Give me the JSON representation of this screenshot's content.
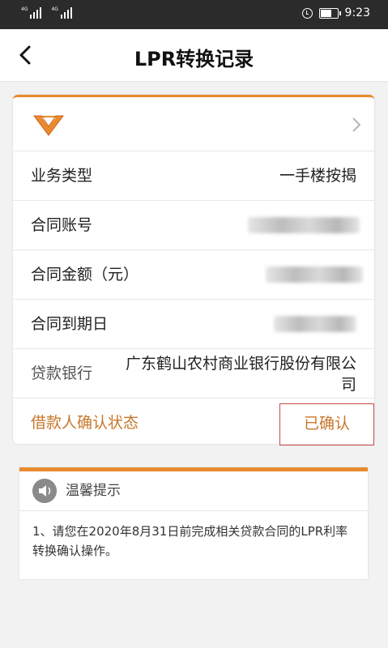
{
  "status_bar": {
    "network_1": "4G",
    "network_2": "4G",
    "time": "9:23",
    "battery_level": 0.6
  },
  "header": {
    "title": "LPR转换记录"
  },
  "record": {
    "rows": [
      {
        "label": "业务类型",
        "value": "一手楼按揭"
      },
      {
        "label": "合同账号",
        "value": ""
      },
      {
        "label": "合同金额（元）",
        "value": ""
      },
      {
        "label": "合同到期日",
        "value": ""
      },
      {
        "label": "贷款银行",
        "value": "广东鹤山农村商业银行股份有限公司"
      }
    ],
    "status": {
      "label": "借款人确认状态",
      "value": "已确认"
    }
  },
  "tip": {
    "title": "温馨提示",
    "text": "1、请您在2020年8月31日前完成相关贷款合同的LPR利率转换确认操作。"
  },
  "colors": {
    "accent": "#e98a2e",
    "status_text": "#c8772b",
    "highlight_border": "#c9494b"
  }
}
